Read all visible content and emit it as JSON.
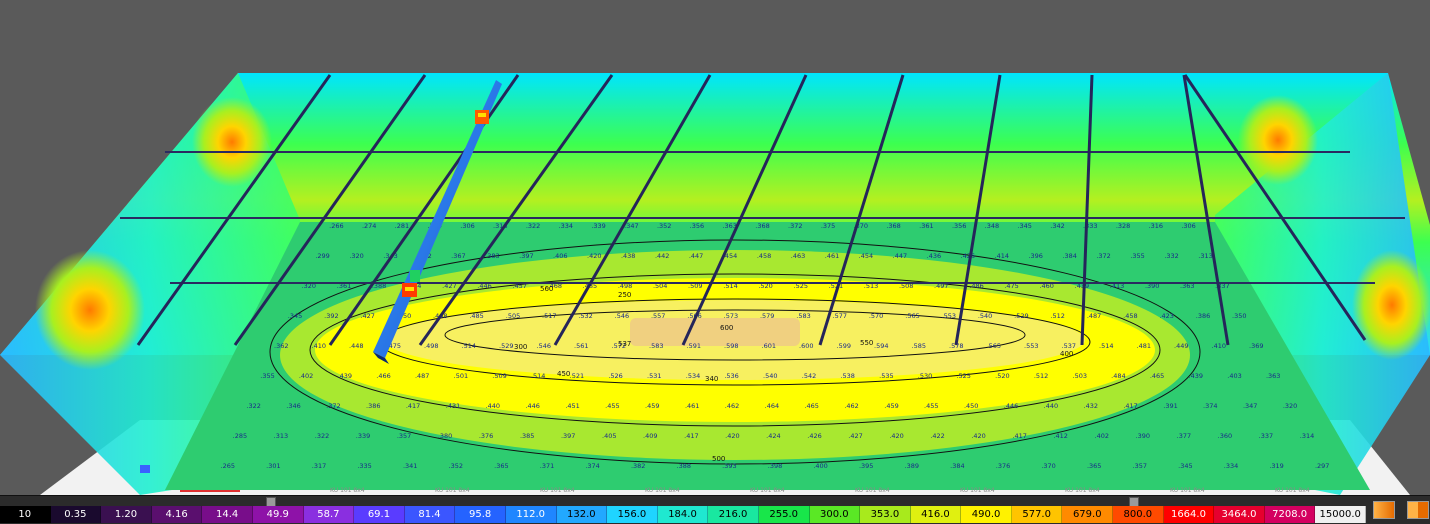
{
  "viewport": {
    "description_icon": "3d-illuminance-view",
    "ceiling_colors": [
      "#00e5ff",
      "#3cff50",
      "#b4f020"
    ],
    "floor_zone_colors": [
      "#2ecc70",
      "#a8e830",
      "#ffff00",
      "#f0d080"
    ],
    "contour_labels": [
      "250",
      "300",
      "340",
      "400",
      "450",
      "500",
      "537",
      "550",
      "560",
      "600"
    ],
    "floor_value_rows": [
      [
        "266",
        "274",
        "281",
        "299",
        "306",
        "316",
        "322",
        "334",
        "339",
        "347",
        "352",
        "356",
        "363",
        "368",
        "372",
        "375",
        "370",
        "368",
        "361",
        "356",
        "348",
        "345",
        "342",
        "333",
        "328",
        "316",
        "306"
      ],
      [
        "299",
        "320",
        "343",
        "352",
        "367",
        "383",
        "397",
        "406",
        "420",
        "438",
        "442",
        "447",
        "454",
        "458",
        "463",
        "461",
        "454",
        "447",
        "436",
        "426",
        "414",
        "396",
        "384",
        "372",
        "355",
        "332",
        "313"
      ],
      [
        "320",
        "361",
        "388",
        "414",
        "427",
        "446",
        "457",
        "468",
        "485",
        "498",
        "504",
        "509",
        "514",
        "520",
        "525",
        "521",
        "513",
        "508",
        "497",
        "486",
        "475",
        "460",
        "439",
        "413",
        "390",
        "363",
        "337"
      ],
      [
        "345",
        "392",
        "427",
        "450",
        "468",
        "485",
        "505",
        "517",
        "532",
        "546",
        "557",
        "566",
        "573",
        "579",
        "583",
        "577",
        "570",
        "565",
        "553",
        "540",
        "529",
        "512",
        "487",
        "458",
        "423",
        "386",
        "350"
      ],
      [
        "362",
        "410",
        "448",
        "475",
        "498",
        "514",
        "529",
        "546",
        "561",
        "572",
        "583",
        "591",
        "598",
        "601",
        "600",
        "599",
        "594",
        "585",
        "578",
        "565",
        "553",
        "537",
        "514",
        "481",
        "449",
        "410",
        "369"
      ],
      [
        "355",
        "402",
        "439",
        "466",
        "487",
        "501",
        "509",
        "514",
        "521",
        "526",
        "531",
        "534",
        "536",
        "540",
        "542",
        "538",
        "535",
        "530",
        "525",
        "520",
        "512",
        "503",
        "484",
        "465",
        "439",
        "403",
        "363"
      ],
      [
        "322",
        "346",
        "372",
        "386",
        "417",
        "431",
        "440",
        "446",
        "451",
        "455",
        "459",
        "461",
        "462",
        "464",
        "465",
        "462",
        "459",
        "455",
        "450",
        "446",
        "440",
        "432",
        "417",
        "391",
        "374",
        "347",
        "320"
      ],
      [
        "285",
        "313",
        "322",
        "339",
        "357",
        "380",
        "376",
        "385",
        "397",
        "405",
        "409",
        "417",
        "420",
        "424",
        "426",
        "427",
        "420",
        "422",
        "420",
        "417",
        "412",
        "402",
        "390",
        "377",
        "360",
        "337",
        "314"
      ],
      [
        "265",
        "301",
        "317",
        "335",
        "341",
        "352",
        "365",
        "371",
        "374",
        "382",
        "388",
        "393",
        "398",
        "400",
        "395",
        "389",
        "384",
        "376",
        "370",
        "365",
        "357",
        "345",
        "334",
        "319",
        "297"
      ]
    ],
    "footer_labels": [
      "KU 101 8x4",
      "KU 101 8x4",
      "KU 101 8x4",
      "KU 101 8x4",
      "KU 101 8x4",
      "KU 101 8x4",
      "KU 101 8x4",
      "KU 101 8x4",
      "KU 101 8x4",
      "KU 101 8x4"
    ]
  },
  "scale_bar": {
    "values": [
      "10",
      "0.35",
      "1.20",
      "4.16",
      "14.4",
      "49.9",
      "58.7",
      "69.1",
      "81.4",
      "95.8",
      "112.0",
      "132.0",
      "156.0",
      "184.0",
      "216.0",
      "255.0",
      "300.0",
      "353.0",
      "416.0",
      "490.0",
      "577.0",
      "679.0",
      "800.0",
      "1664.0",
      "3464.0",
      "7208.0",
      "15000.0"
    ],
    "colors": [
      "#000000",
      "#1a0a2e",
      "#3a1050",
      "#5a0f6e",
      "#780d8a",
      "#8e12a8",
      "#8a2fe0",
      "#5a3cff",
      "#3b56ff",
      "#2563ff",
      "#1f86ff",
      "#22a8ff",
      "#1fd4ff",
      "#1fe8d0",
      "#19e8a0",
      "#18e64a",
      "#5ae825",
      "#a8ea1c",
      "#e0f010",
      "#fff200",
      "#ffc400",
      "#ff8a00",
      "#ff4a00",
      "#ff0000",
      "#e6002e",
      "#d40060",
      "#f0f0f0"
    ],
    "text_colors": [
      "#ffffff",
      "#ffffff",
      "#ffffff",
      "#ffffff",
      "#ffffff",
      "#ffffff",
      "#ffffff",
      "#ffffff",
      "#ffffff",
      "#ffffff",
      "#ffffff",
      "#000000",
      "#000000",
      "#000000",
      "#000000",
      "#000000",
      "#000000",
      "#000000",
      "#000000",
      "#000000",
      "#000000",
      "#000000",
      "#000000",
      "#ffffff",
      "#ffffff",
      "#ffffff",
      "#000000"
    ],
    "mode_buttons": [
      "color-mode-icon",
      "color-mode-icon"
    ]
  }
}
